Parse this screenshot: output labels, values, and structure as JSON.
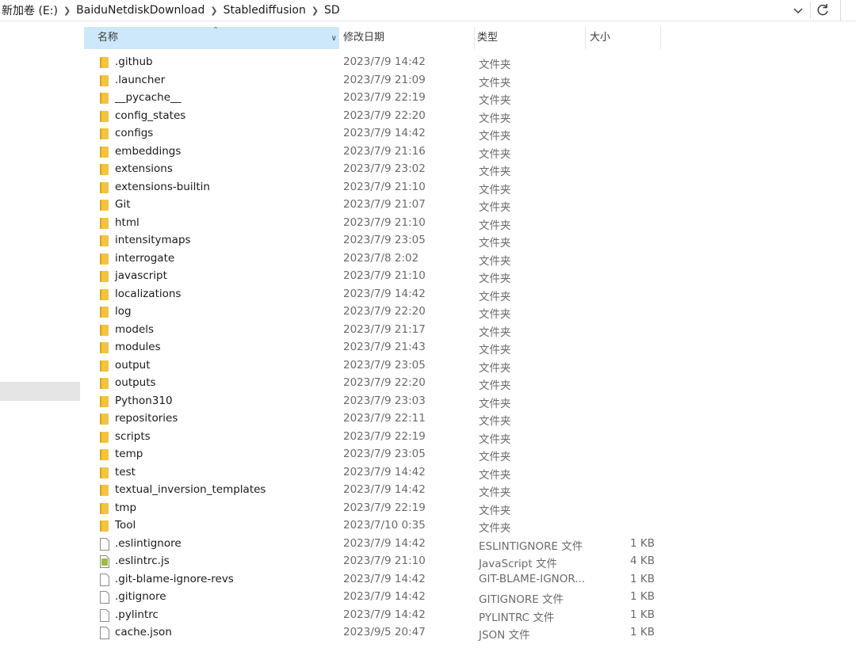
{
  "address": {
    "crumbs": [
      "新加卷 (E:)",
      "BaiduNetdiskDownload",
      "Stablediffusion",
      "SD"
    ]
  },
  "columns": {
    "name": "名称",
    "date": "修改日期",
    "type": "类型",
    "size": "大小"
  },
  "icons": {
    "folder": "folder-icon",
    "file": "file-icon",
    "js": "javascript-file-icon",
    "dropdown": "chevron-down-icon",
    "refresh": "refresh-icon"
  },
  "colors": {
    "header_selected": "#cde8fb",
    "folder": "#f2c440",
    "nav_selected": "#e5e5e5"
  },
  "files": [
    {
      "name": ".github",
      "date": "2023/7/9 14:42",
      "type": "文件夹",
      "size": "",
      "kind": "folder"
    },
    {
      "name": ".launcher",
      "date": "2023/7/9 21:09",
      "type": "文件夹",
      "size": "",
      "kind": "folder"
    },
    {
      "name": "__pycache__",
      "date": "2023/7/9 22:19",
      "type": "文件夹",
      "size": "",
      "kind": "folder"
    },
    {
      "name": "config_states",
      "date": "2023/7/9 22:20",
      "type": "文件夹",
      "size": "",
      "kind": "folder"
    },
    {
      "name": "configs",
      "date": "2023/7/9 14:42",
      "type": "文件夹",
      "size": "",
      "kind": "folder"
    },
    {
      "name": "embeddings",
      "date": "2023/7/9 21:16",
      "type": "文件夹",
      "size": "",
      "kind": "folder"
    },
    {
      "name": "extensions",
      "date": "2023/7/9 23:02",
      "type": "文件夹",
      "size": "",
      "kind": "folder"
    },
    {
      "name": "extensions-builtin",
      "date": "2023/7/9 21:10",
      "type": "文件夹",
      "size": "",
      "kind": "folder"
    },
    {
      "name": "Git",
      "date": "2023/7/9 21:07",
      "type": "文件夹",
      "size": "",
      "kind": "folder"
    },
    {
      "name": "html",
      "date": "2023/7/9 21:10",
      "type": "文件夹",
      "size": "",
      "kind": "folder"
    },
    {
      "name": "intensitymaps",
      "date": "2023/7/9 23:05",
      "type": "文件夹",
      "size": "",
      "kind": "folder"
    },
    {
      "name": "interrogate",
      "date": "2023/7/8 2:02",
      "type": "文件夹",
      "size": "",
      "kind": "folder"
    },
    {
      "name": "javascript",
      "date": "2023/7/9 21:10",
      "type": "文件夹",
      "size": "",
      "kind": "folder"
    },
    {
      "name": "localizations",
      "date": "2023/7/9 14:42",
      "type": "文件夹",
      "size": "",
      "kind": "folder"
    },
    {
      "name": "log",
      "date": "2023/7/9 22:20",
      "type": "文件夹",
      "size": "",
      "kind": "folder"
    },
    {
      "name": "models",
      "date": "2023/7/9 21:17",
      "type": "文件夹",
      "size": "",
      "kind": "folder"
    },
    {
      "name": "modules",
      "date": "2023/7/9 21:43",
      "type": "文件夹",
      "size": "",
      "kind": "folder"
    },
    {
      "name": "output",
      "date": "2023/7/9 23:05",
      "type": "文件夹",
      "size": "",
      "kind": "folder"
    },
    {
      "name": "outputs",
      "date": "2023/7/9 22:20",
      "type": "文件夹",
      "size": "",
      "kind": "folder"
    },
    {
      "name": "Python310",
      "date": "2023/7/9 23:03",
      "type": "文件夹",
      "size": "",
      "kind": "folder"
    },
    {
      "name": "repositories",
      "date": "2023/7/9 22:11",
      "type": "文件夹",
      "size": "",
      "kind": "folder"
    },
    {
      "name": "scripts",
      "date": "2023/7/9 22:19",
      "type": "文件夹",
      "size": "",
      "kind": "folder"
    },
    {
      "name": "temp",
      "date": "2023/7/9 23:05",
      "type": "文件夹",
      "size": "",
      "kind": "folder"
    },
    {
      "name": "test",
      "date": "2023/7/9 14:42",
      "type": "文件夹",
      "size": "",
      "kind": "folder"
    },
    {
      "name": "textual_inversion_templates",
      "date": "2023/7/9 14:42",
      "type": "文件夹",
      "size": "",
      "kind": "folder"
    },
    {
      "name": "tmp",
      "date": "2023/7/9 22:19",
      "type": "文件夹",
      "size": "",
      "kind": "folder"
    },
    {
      "name": "Tool",
      "date": "2023/7/10 0:35",
      "type": "文件夹",
      "size": "",
      "kind": "folder"
    },
    {
      "name": ".eslintignore",
      "date": "2023/7/9 14:42",
      "type": "ESLINTIGNORE 文件",
      "size": "1 KB",
      "kind": "file"
    },
    {
      "name": ".eslintrc.js",
      "date": "2023/7/9 21:10",
      "type": "JavaScript 文件",
      "size": "4 KB",
      "kind": "js"
    },
    {
      "name": ".git-blame-ignore-revs",
      "date": "2023/7/9 14:42",
      "type": "GIT-BLAME-IGNOR...",
      "size": "1 KB",
      "kind": "file"
    },
    {
      "name": ".gitignore",
      "date": "2023/7/9 14:42",
      "type": "GITIGNORE 文件",
      "size": "1 KB",
      "kind": "file"
    },
    {
      "name": ".pylintrc",
      "date": "2023/7/9 14:42",
      "type": "PYLINTRC 文件",
      "size": "1 KB",
      "kind": "file"
    },
    {
      "name": "cache.json",
      "date": "2023/9/5 20:47",
      "type": "JSON 文件",
      "size": "1 KB",
      "kind": "file"
    }
  ]
}
